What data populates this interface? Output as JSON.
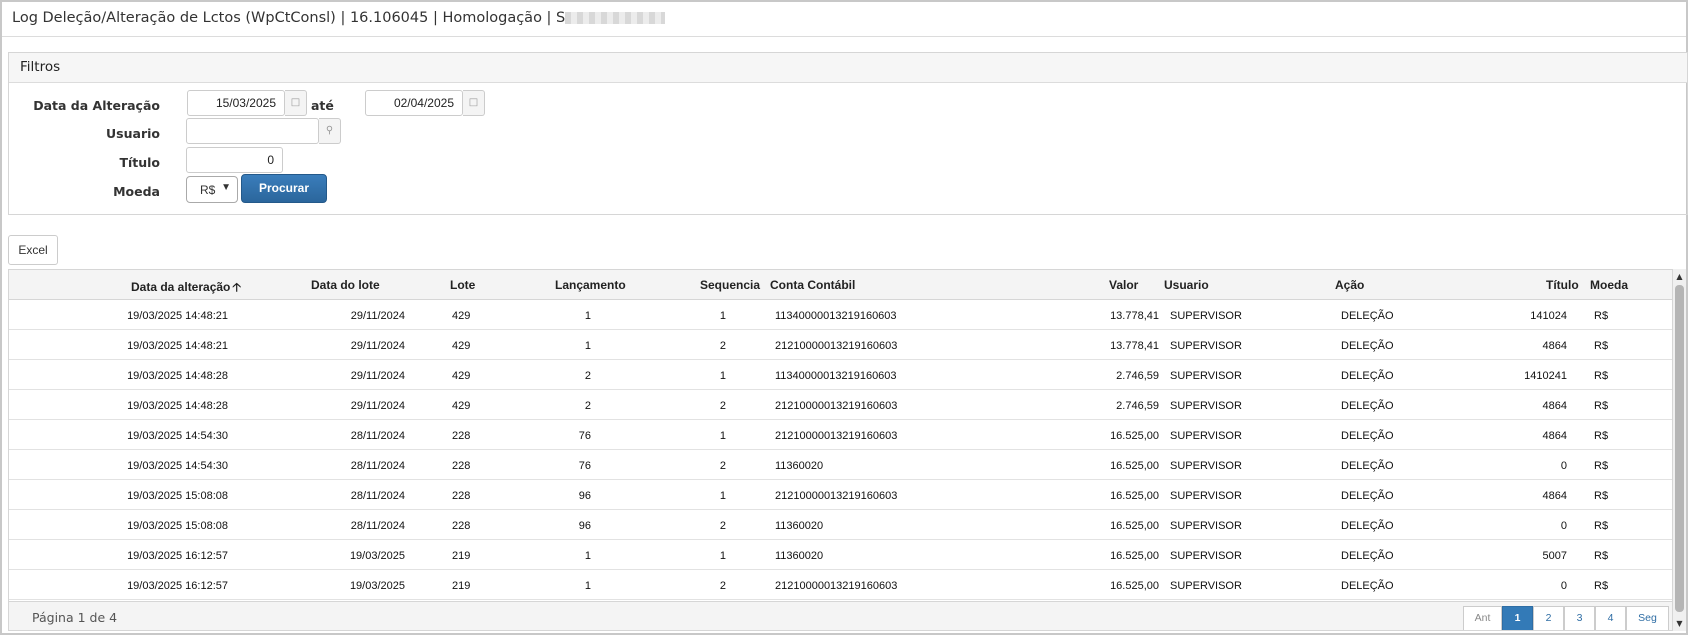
{
  "window": {
    "title": "Log Deleção/Alteração de Lctos (WpCtConsl) | 16.106045 | Homologação | S"
  },
  "filters": {
    "header": "Filtros",
    "date_label": "Data da Alteração",
    "date_from": "15/03/2025",
    "date_sep": "até",
    "date_to": "02/04/2025",
    "user_label": "Usuario",
    "user_value": "",
    "title_label": "Título",
    "title_value": "0",
    "currency_label": "Moeda",
    "currency_value": "R$",
    "search_button": "Procurar"
  },
  "toolbar": {
    "excel_button": "Excel"
  },
  "table": {
    "columns": {
      "data_alteracao": "Data da alteração",
      "data_lote": "Data do lote",
      "lote": "Lote",
      "lancamento": "Lançamento",
      "sequencia": "Sequencia",
      "conta": "Conta Contábil",
      "valor": "Valor",
      "usuario": "Usuario",
      "acao": "Ação",
      "titulo": "Título",
      "moeda": "Moeda"
    },
    "sort_icon": "arrow-up-icon",
    "rows": [
      [
        "19/03/2025 14:48:21",
        "29/11/2024",
        "429",
        "1",
        "1",
        "11340000013219160603",
        "13.778,41",
        "SUPERVISOR",
        "DELEÇÃO",
        "141024",
        "R$"
      ],
      [
        "19/03/2025 14:48:21",
        "29/11/2024",
        "429",
        "1",
        "2",
        "21210000013219160603",
        "13.778,41",
        "SUPERVISOR",
        "DELEÇÃO",
        "4864",
        "R$"
      ],
      [
        "19/03/2025 14:48:28",
        "29/11/2024",
        "429",
        "2",
        "1",
        "11340000013219160603",
        "2.746,59",
        "SUPERVISOR",
        "DELEÇÃO",
        "1410241",
        "R$"
      ],
      [
        "19/03/2025 14:48:28",
        "29/11/2024",
        "429",
        "2",
        "2",
        "21210000013219160603",
        "2.746,59",
        "SUPERVISOR",
        "DELEÇÃO",
        "4864",
        "R$"
      ],
      [
        "19/03/2025 14:54:30",
        "28/11/2024",
        "228",
        "76",
        "1",
        "21210000013219160603",
        "16.525,00",
        "SUPERVISOR",
        "DELEÇÃO",
        "4864",
        "R$"
      ],
      [
        "19/03/2025 14:54:30",
        "28/11/2024",
        "228",
        "76",
        "2",
        "11360020",
        "16.525,00",
        "SUPERVISOR",
        "DELEÇÃO",
        "0",
        "R$"
      ],
      [
        "19/03/2025 15:08:08",
        "28/11/2024",
        "228",
        "96",
        "1",
        "21210000013219160603",
        "16.525,00",
        "SUPERVISOR",
        "DELEÇÃO",
        "4864",
        "R$"
      ],
      [
        "19/03/2025 15:08:08",
        "28/11/2024",
        "228",
        "96",
        "2",
        "11360020",
        "16.525,00",
        "SUPERVISOR",
        "DELEÇÃO",
        "0",
        "R$"
      ],
      [
        "19/03/2025 16:12:57",
        "19/03/2025",
        "219",
        "1",
        "1",
        "11360020",
        "16.525,00",
        "SUPERVISOR",
        "DELEÇÃO",
        "5007",
        "R$"
      ],
      [
        "19/03/2025 16:12:57",
        "19/03/2025",
        "219",
        "1",
        "2",
        "21210000013219160603",
        "16.525,00",
        "SUPERVISOR",
        "DELEÇÃO",
        "0",
        "R$"
      ]
    ]
  },
  "pagination": {
    "info": "Página 1 de 4",
    "prev": "Ant",
    "pages": [
      "1",
      "2",
      "3",
      "4"
    ],
    "current": "1",
    "next": "Seg"
  },
  "icons": {
    "calendar": "calendar-icon",
    "search": "search-icon",
    "dropdown": "chevron-down-icon"
  },
  "colors": {
    "primary": "#2e6da4",
    "header_bg": "#f4f4f4",
    "border": "#d6d6d6"
  }
}
